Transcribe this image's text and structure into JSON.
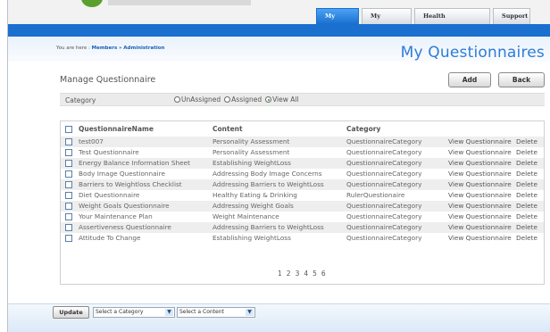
{
  "header": {
    "tabs": [
      {
        "label": "My Tools",
        "active": true
      },
      {
        "label": "My Account",
        "active": false
      },
      {
        "label": "Health Information",
        "active": false
      },
      {
        "label": "Support",
        "active": false
      }
    ]
  },
  "breadcrumb": {
    "prefix": "You are here :",
    "members": "Members",
    "separator": "»",
    "administration": "Administration"
  },
  "page_title": "My Questionnaires",
  "section_title": "Manage Questionnaire",
  "buttons": {
    "add": "Add",
    "back": "Back",
    "update": "Update"
  },
  "category_filter": {
    "label": "Category",
    "options": [
      {
        "label": "UnAssigned",
        "selected": false
      },
      {
        "label": "Assigned",
        "selected": false
      },
      {
        "label": "View All",
        "selected": true
      }
    ]
  },
  "table": {
    "headers": {
      "name": "QuestionnaireName",
      "content": "Content",
      "category": "Category"
    },
    "rows": [
      {
        "name": "test007",
        "content": "Personality Assessment",
        "category": "QuestionnaireCategory",
        "view": "View Questionnaire",
        "delete": "Delete"
      },
      {
        "name": "Test Questionnaire",
        "content": "Personality Assessment",
        "category": "QuestionnaireCategory",
        "view": "View Questionnaire",
        "delete": "Delete"
      },
      {
        "name": "Energy Balance Information Sheet",
        "content": "Establishing WeightLoss",
        "category": "QuestionnaireCategory",
        "view": "View Questionnaire",
        "delete": "Delete"
      },
      {
        "name": "Body Image Questionnaire",
        "content": "Addressing Body Image Concerns",
        "category": "QuestionnaireCategory",
        "view": "View Questionnaire",
        "delete": "Delete"
      },
      {
        "name": "Barriers to Weightloss Checklist",
        "content": "Addressing Barriers to WeightLoss",
        "category": "QuestionnaireCategory",
        "view": "View Questionnaire",
        "delete": "Delete"
      },
      {
        "name": "Diet Questionnaire",
        "content": "Healthy Eating & Drinking",
        "category": "RulerQuestionaire",
        "view": "View Questionnaire",
        "delete": "Delete"
      },
      {
        "name": "Weight Goals Questionnaire",
        "content": "Addressing Weight Goals",
        "category": "QuestionnaireCategory",
        "view": "View Questionnaire",
        "delete": "Delete"
      },
      {
        "name": "Your Maintenance Plan",
        "content": "Weight Maintenance",
        "category": "QuestionnaireCategory",
        "view": "View Questionnaire",
        "delete": "Delete"
      },
      {
        "name": "Assertiveness Questionnaire",
        "content": "Addressing Barriers to WeightLoss",
        "category": "QuestionnaireCategory",
        "view": "View Questionnaire",
        "delete": "Delete"
      },
      {
        "name": "Attitude To Change",
        "content": "Establishing WeightLoss",
        "category": "QuestionnaireCategory",
        "view": "View Questionnaire",
        "delete": "Delete"
      }
    ]
  },
  "pager": [
    "1",
    "2",
    "3",
    "4",
    "5",
    "6"
  ],
  "bottom": {
    "category_select": "Select a Category",
    "content_select": "Select a Content"
  }
}
